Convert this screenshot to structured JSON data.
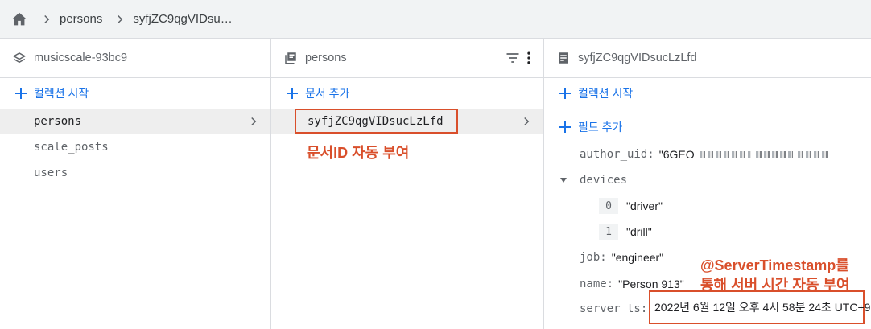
{
  "breadcrumb": {
    "items": [
      "persons",
      "syfjZC9qgVIDsu…"
    ]
  },
  "col1": {
    "title": "musicscale-93bc9",
    "add_label": "컬렉션 시작",
    "items": [
      "persons",
      "scale_posts",
      "users"
    ]
  },
  "col2": {
    "title": "persons",
    "add_label": "문서 추가",
    "doc_id": "syfjZC9qgVIDsucLzLfd",
    "annotation": "문서ID 자동 부여"
  },
  "col3": {
    "title": "syfjZC9qgVIDsucLzLfd",
    "add_collection_label": "컬렉션 시작",
    "add_field_label": "필드 추가",
    "fields": {
      "author_uid_key": "author_uid:",
      "author_uid_value": "\"6GEO",
      "devices_key": "devices",
      "devices": [
        {
          "index": "0",
          "value": "\"driver\""
        },
        {
          "index": "1",
          "value": "\"drill\""
        }
      ],
      "job_key": "job:",
      "job_value": "\"engineer\"",
      "name_key": "name:",
      "name_value": "\"Person 913\"",
      "server_ts_key": "server_ts:",
      "server_ts_value": "2022년 6월 12일 오후 4시 58분 24초 UTC+9"
    },
    "annotation_line1": "@ServerTimestamp를",
    "annotation_line2": "통해 서버 시간 자동 부여"
  },
  "icons": [
    "home-icon",
    "chevron-right-icon",
    "firestore-db-icon",
    "collection-icon",
    "filter-icon",
    "more-vert-icon",
    "document-icon",
    "plus-icon",
    "expand-arrow-icon"
  ],
  "colors": {
    "accent": "#1a73e8",
    "annotation": "#d94f2b",
    "selected_bg": "#eeeeee",
    "header_bg": "#f1f3f4"
  }
}
